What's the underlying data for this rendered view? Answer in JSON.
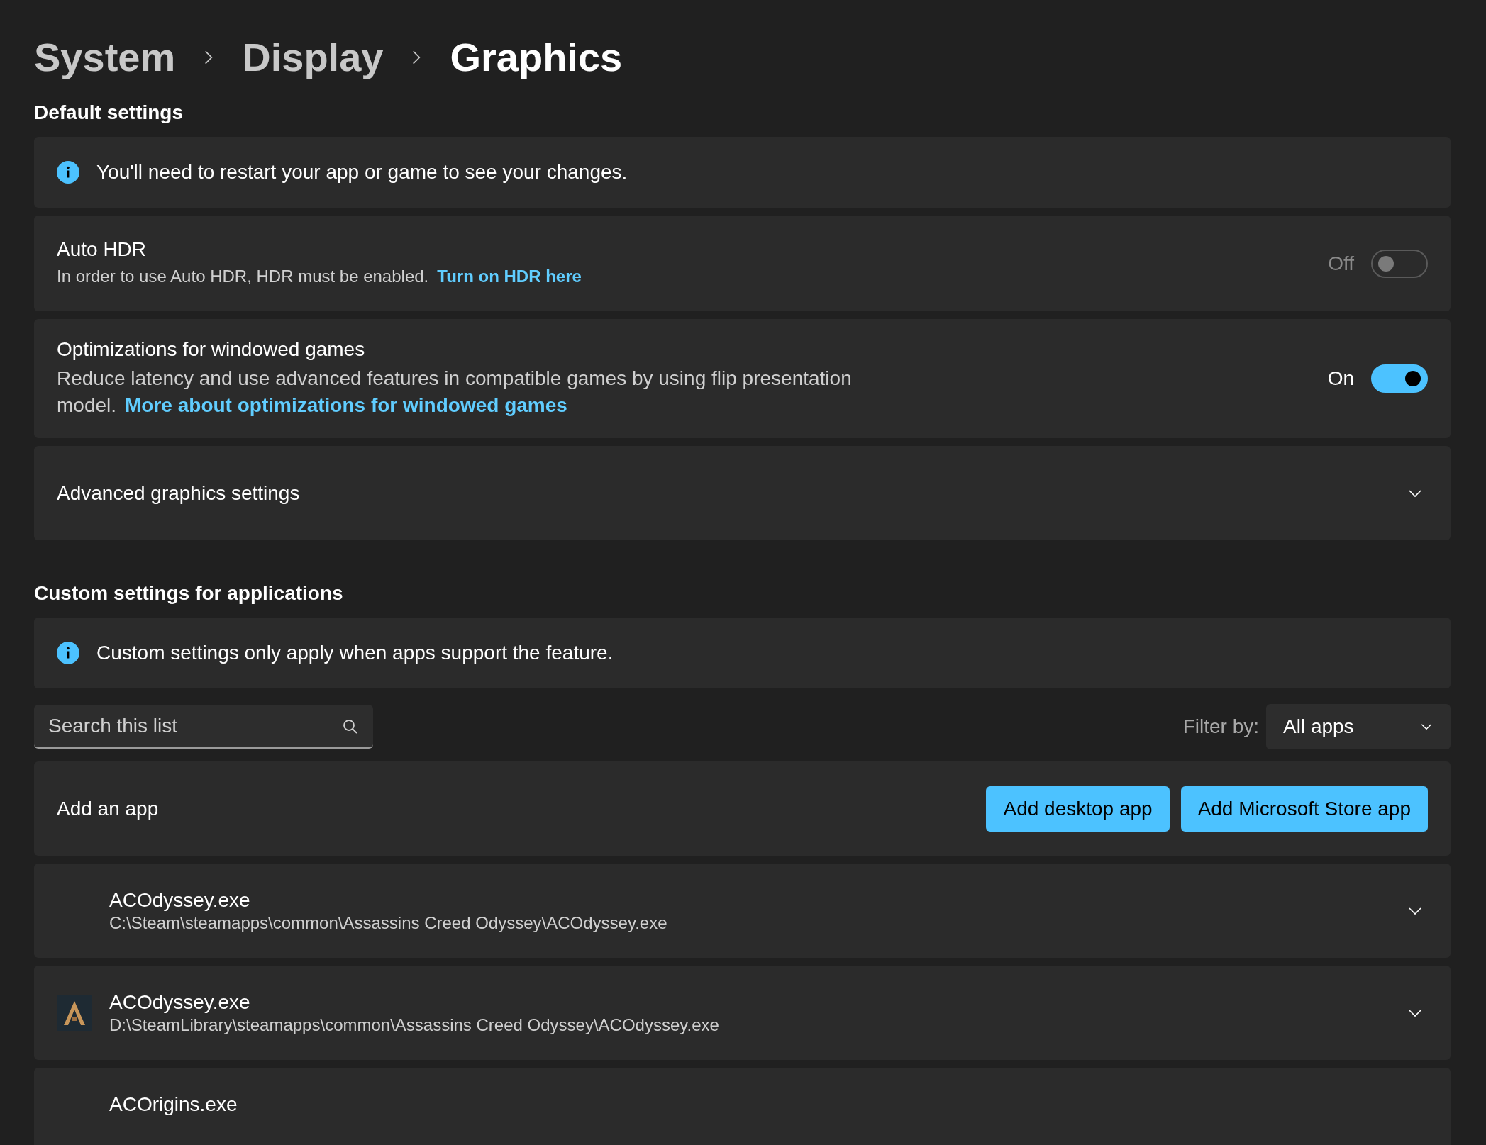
{
  "breadcrumb": [
    {
      "label": "System",
      "current": false
    },
    {
      "label": "Display",
      "current": false
    },
    {
      "label": "Graphics",
      "current": true
    }
  ],
  "default_settings": {
    "heading": "Default settings",
    "notice": "You'll need to restart your app or game to see your changes.",
    "settings": [
      {
        "kind": "toggle",
        "title": "Auto HDR",
        "description": "In order to use Auto HDR, HDR must be enabled.",
        "link": "Turn on HDR here",
        "state_label": "Off",
        "on": false,
        "disabled": true
      },
      {
        "kind": "toggle",
        "title": "Optimizations for windowed games",
        "description": "Reduce latency and use advanced features in compatible games by using flip presentation model.",
        "link": "More about optimizations for windowed games",
        "state_label": "On",
        "on": true,
        "disabled": false
      },
      {
        "kind": "expander",
        "title": "Advanced graphics settings"
      }
    ]
  },
  "custom_settings": {
    "heading": "Custom settings for applications",
    "notice": "Custom settings only apply when apps support the feature.",
    "search": {
      "placeholder": "Search this list"
    },
    "filter": {
      "label": "Filter by:",
      "value": "All apps"
    },
    "add_app": {
      "label": "Add an app",
      "buttons": [
        "Add desktop app",
        "Add Microsoft Store app"
      ]
    },
    "apps": [
      {
        "name": "ACOdyssey.exe",
        "path": "C:\\Steam\\steamapps\\common\\Assassins Creed Odyssey\\ACOdyssey.exe",
        "icon": false
      },
      {
        "name": "ACOdyssey.exe",
        "path": "D:\\SteamLibrary\\steamapps\\common\\Assassins Creed Odyssey\\ACOdyssey.exe",
        "icon": true
      },
      {
        "name": "ACOrigins.exe",
        "icon": false
      }
    ]
  }
}
